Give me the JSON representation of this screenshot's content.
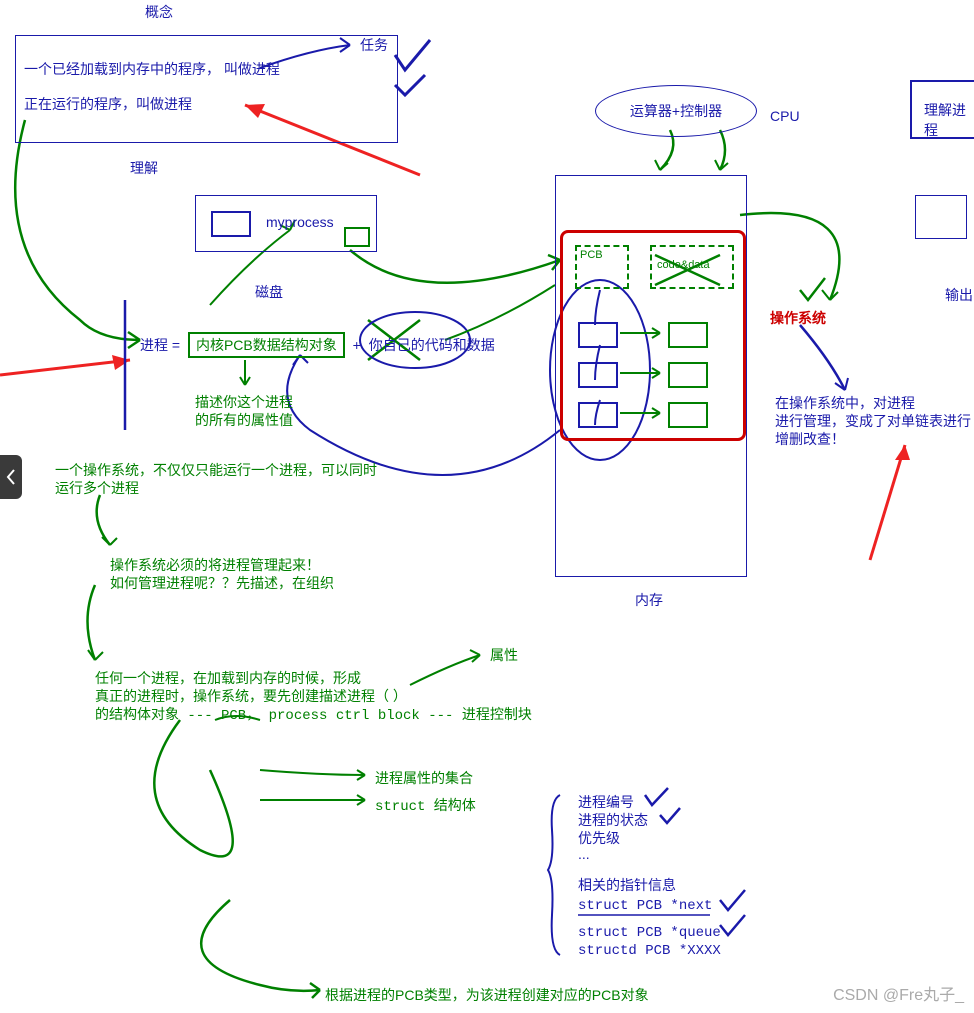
{
  "header": {
    "concept_label": "概念",
    "task_label": "任务"
  },
  "concept_box": {
    "line1": "一个已经加载到内存中的程序，  叫做进程",
    "line2": "正在运行的程序，叫做进程"
  },
  "understand_label": "理解",
  "myprocess": {
    "label": "myprocess",
    "disk_label": "磁盘"
  },
  "cpu": {
    "alu_ctrl": "运算器+控制器",
    "label": "CPU"
  },
  "process_eq": {
    "prefix": "进程 =",
    "pcb_obj": "内核PCB数据结构对象",
    "plus": "+",
    "code_data": "你自己的代码和数据",
    "desc_l1": "描述你这个进程",
    "desc_l2": "的所有的属性值"
  },
  "memory": {
    "pcb_label": "PCB",
    "code_data_label": "code&data",
    "mem_label": "内存"
  },
  "os_label": "操作系统",
  "os_mgmt": {
    "l1": "在操作系统中，对进程",
    "l2": "进行管理，变成了对单链表进行",
    "l3": "增删改查！"
  },
  "multi_process": {
    "l1": "一个操作系统，不仅仅只能运行一个进程，可以同时",
    "l2": "运行多个进程"
  },
  "os_manage": {
    "l1": "操作系统必须的将进程管理起来！",
    "l2": "如何管理进程呢？？先描述，在组织"
  },
  "pcb_create": {
    "l1": "任何一个进程，在加载到内存的时候，形成",
    "l2": "真正的进程时，操作系统，要先创建描述进程（      ）",
    "l3": "的结构体对象 --- PCB，  process ctrl block --- 进程控制块"
  },
  "attribute_label": "属性",
  "attr_set": "进程属性的集合",
  "struct_label": "struct 结构体",
  "struct_members": {
    "m1": "进程编号",
    "m2": "进程的状态",
    "m3": "优先级",
    "m4": "...",
    "m5": "相关的指针信息",
    "m6": "struct PCB *next",
    "m7": "struct PCB *queue",
    "m8": "structd PCB *XXXX"
  },
  "pcb_type_create": "根据进程的PCB类型，为该进程创建对应的PCB对象",
  "right_boxes": {
    "understand_proc": "理解进程",
    "output": "输出"
  },
  "watermark": "CSDN @Fre丸子_"
}
